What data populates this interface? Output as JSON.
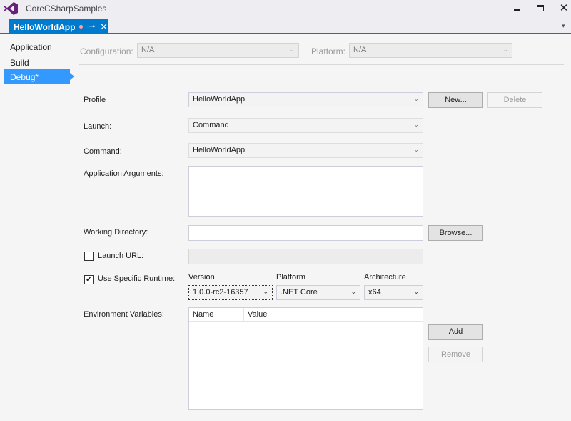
{
  "window": {
    "title": "CoreCSharpSamples",
    "minimize": "—",
    "close": "✕"
  },
  "tab": {
    "label": "HelloWorldApp",
    "pin": "⊸",
    "close": "✕"
  },
  "sidebar": {
    "items": [
      {
        "label": "Application"
      },
      {
        "label": "Build"
      },
      {
        "label": "Debug*"
      }
    ]
  },
  "config": {
    "configuration_label": "Configuration:",
    "configuration_value": "N/A",
    "platform_label": "Platform:",
    "platform_value": "N/A"
  },
  "debug": {
    "profile_label": "Profile",
    "profile_value": "HelloWorldApp",
    "new_button": "New...",
    "delete_button": "Delete",
    "launch_label": "Launch:",
    "launch_value": "Command",
    "command_label": "Command:",
    "command_value": "HelloWorldApp",
    "app_args_label": "Application Arguments:",
    "app_args_value": "",
    "working_dir_label": "Working Directory:",
    "working_dir_value": "",
    "browse_button": "Browse...",
    "launch_url_label": "Launch URL:",
    "launch_url_checked": false,
    "launch_url_value": "",
    "specific_runtime_label": "Use Specific Runtime:",
    "specific_runtime_checked": true,
    "version_label": "Version",
    "version_value": "1.0.0-rc2-16357",
    "platform_label": "Platform",
    "platform_value": ".NET Core",
    "architecture_label": "Architecture",
    "architecture_value": "x64",
    "env_vars_label": "Environment Variables:",
    "env_columns": [
      "Name",
      "Value"
    ],
    "add_button": "Add",
    "remove_button": "Remove"
  },
  "colors": {
    "accent": "#007acc",
    "selected": "#3399ff"
  }
}
